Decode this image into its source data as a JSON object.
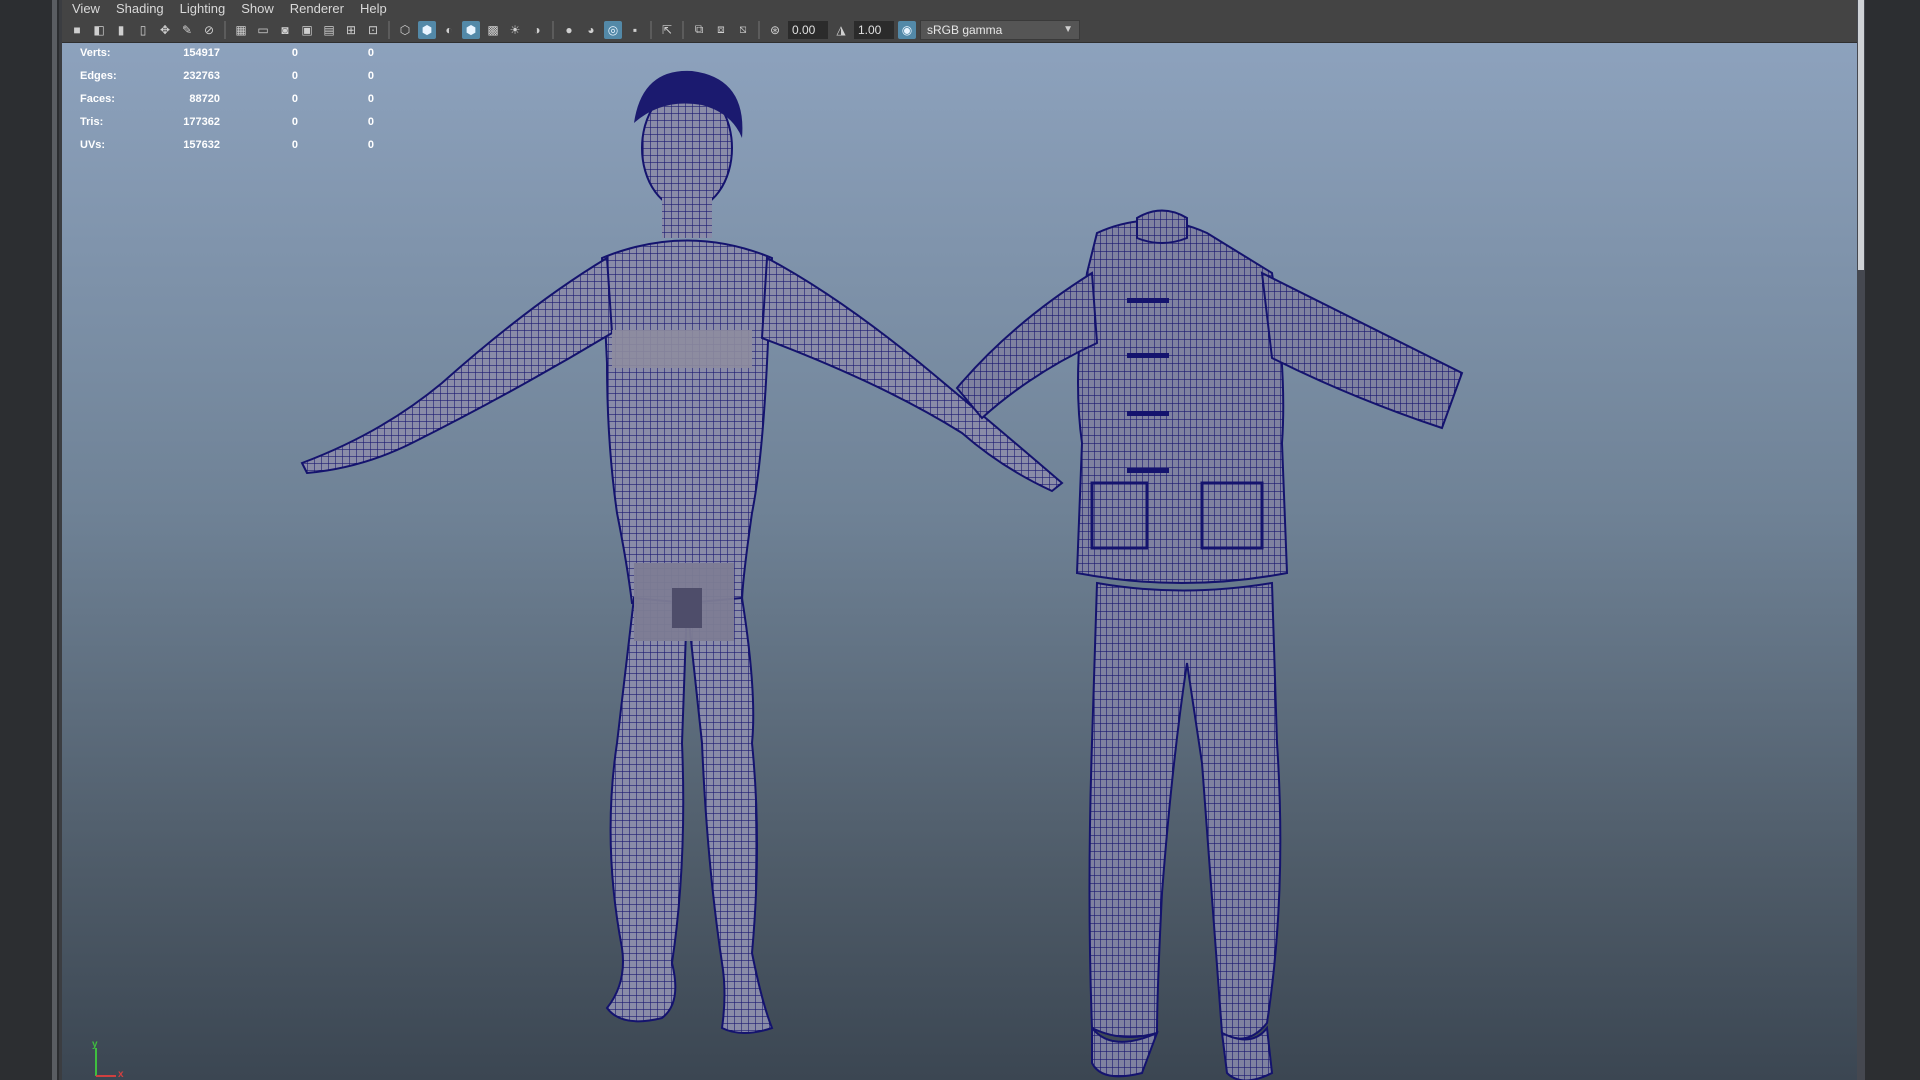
{
  "menu": [
    "View",
    "Shading",
    "Lighting",
    "Show",
    "Renderer",
    "Help"
  ],
  "toolbar": {
    "exposure_value": "0.00",
    "gamma_value": "1.00",
    "color_space": "sRGB gamma"
  },
  "hud": {
    "rows": [
      {
        "label": "Verts:",
        "value": "154917",
        "col2": "0",
        "col3": "0"
      },
      {
        "label": "Edges:",
        "value": "232763",
        "col2": "0",
        "col3": "0"
      },
      {
        "label": "Faces:",
        "value": "88720",
        "col2": "0",
        "col3": "0"
      },
      {
        "label": "Tris:",
        "value": "177362",
        "col2": "0",
        "col3": "0"
      },
      {
        "label": "UVs:",
        "value": "157632",
        "col2": "0",
        "col3": "0"
      }
    ]
  },
  "axis": {
    "y": "y",
    "x": "x"
  },
  "colors": {
    "wireframe": "#14136e",
    "viewport_top": "#8da2bd",
    "viewport_bottom": "#3b4652",
    "active_icon": "#5389a8"
  }
}
